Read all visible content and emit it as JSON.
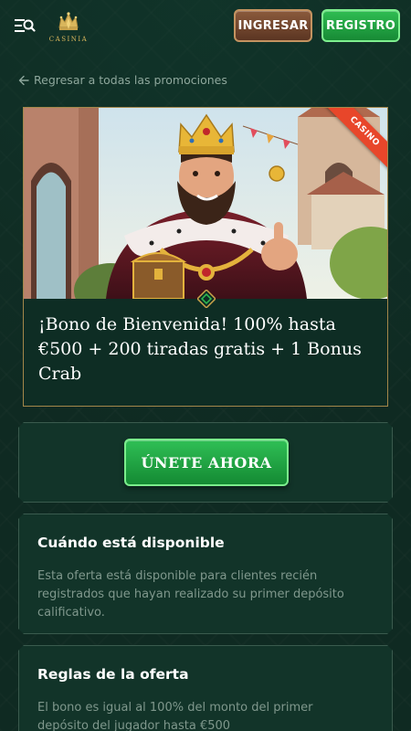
{
  "header": {
    "logo_text": "CASINIA",
    "login_label": "INGRESAR",
    "register_label": "REGISTRO"
  },
  "back_link": "Regresar a todas las promociones",
  "promo": {
    "badge": "CASINO",
    "title": "¡Bono de Bienvenida! 100% hasta €500 + 200 tiradas gratis + 1 Bonus Crab"
  },
  "cta": {
    "label": "ÚNETE AHORA"
  },
  "availability": {
    "heading": "Cuándo está disponible",
    "text": "Esta oferta está disponible para clientes recién registrados que hayan realizado su primer depósito calificativo."
  },
  "rules": {
    "heading": "Reglas de la oferta",
    "text": "El bono es igual al 100% del monto del primer depósito del jugador hasta €500"
  },
  "colors": {
    "background": "#0f2a22",
    "gold": "#d9b65c",
    "green_button": "#2fbd52",
    "brown_button": "#8b5a3c",
    "ribbon": "#e8462a"
  }
}
